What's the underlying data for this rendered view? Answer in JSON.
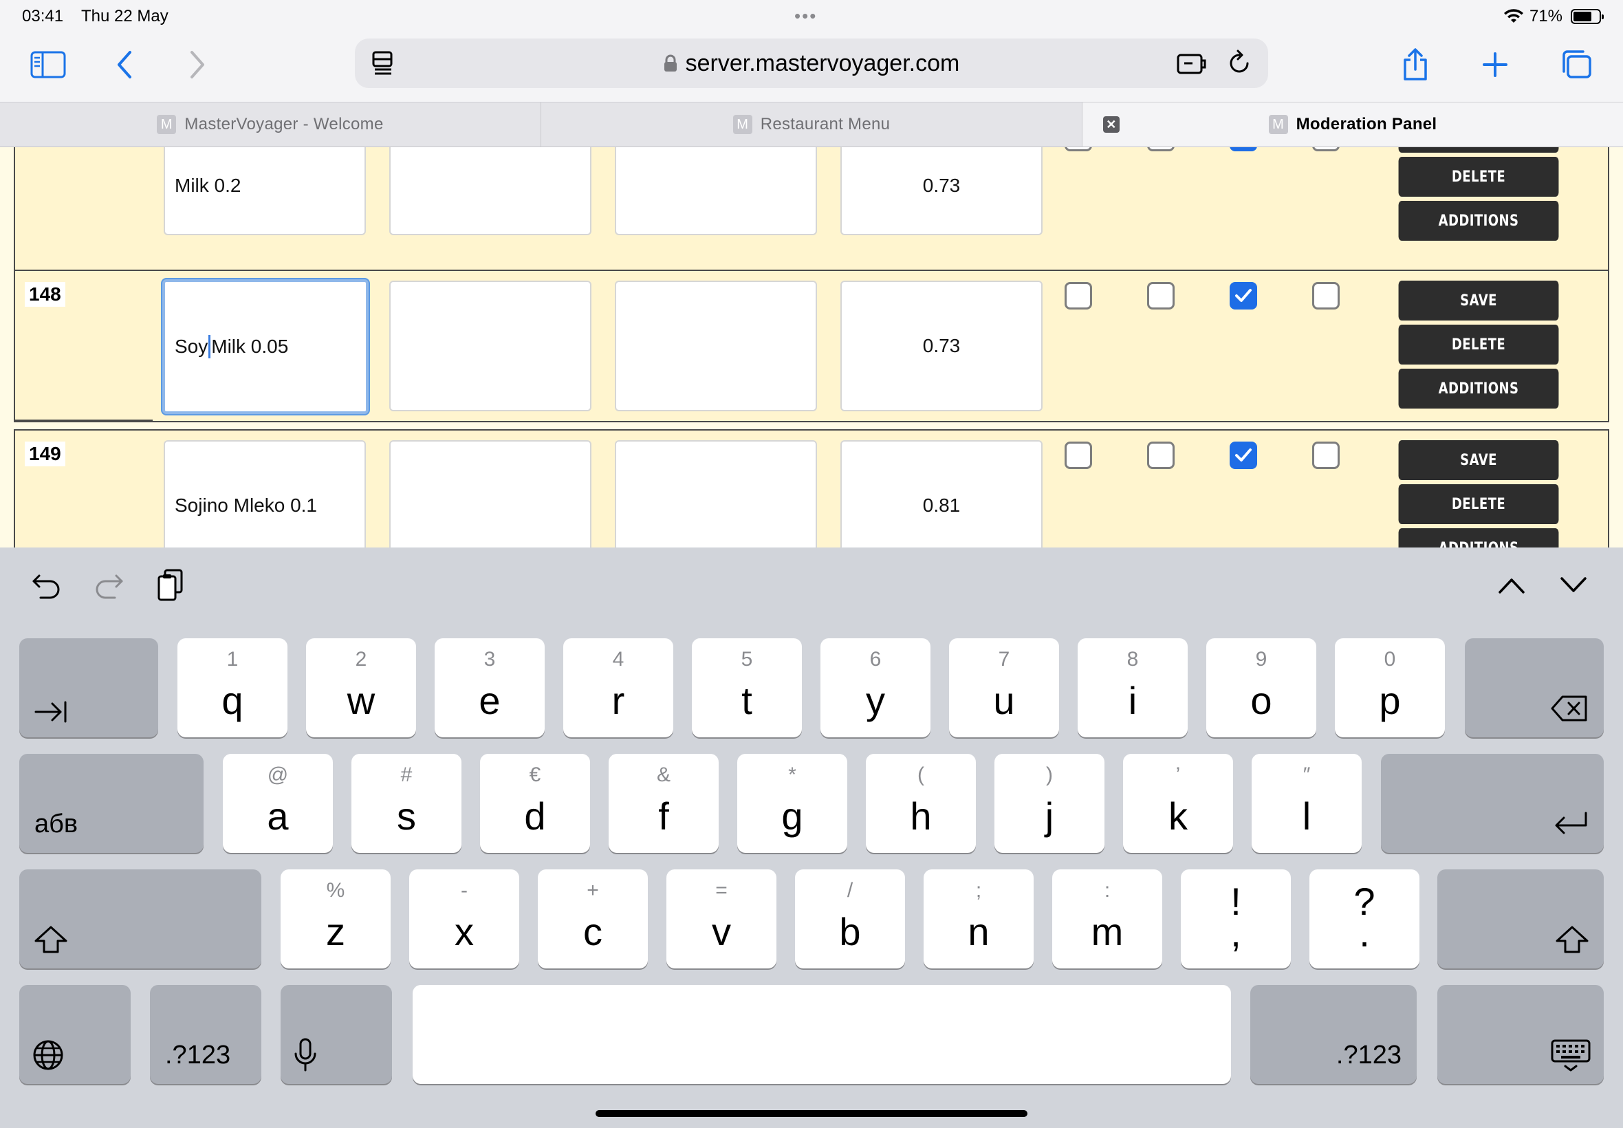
{
  "status": {
    "time": "03:41",
    "date": "Thu 22 May",
    "battery": "71%",
    "battery_level": 0.71
  },
  "toolbar": {
    "url": "server.mastervoyager.com"
  },
  "tabs": [
    {
      "favicon": "M",
      "label": "MasterVoyager - Welcome"
    },
    {
      "favicon": "M",
      "label": "Restaurant Menu"
    },
    {
      "favicon": "M",
      "label": "Moderation Panel",
      "active": true
    }
  ],
  "rows": [
    {
      "id": "",
      "name": "Milk 0.2",
      "price": "0.73",
      "checks": [
        false,
        false,
        true,
        false
      ]
    },
    {
      "id": "148",
      "name_before": "Soy ",
      "name_after": "Milk 0.05",
      "price": "0.73",
      "checks": [
        false,
        false,
        true,
        false
      ]
    },
    {
      "id": "149",
      "name": "Sojino Mleko 0.1",
      "price": "0.81",
      "checks": [
        false,
        false,
        true,
        false
      ]
    }
  ],
  "buttons": {
    "save": "SAVE",
    "delete": "DELETE",
    "additions": "ADDITIONS"
  },
  "keyboard": {
    "row1": [
      {
        "sec": "1",
        "pri": "q"
      },
      {
        "sec": "2",
        "pri": "w"
      },
      {
        "sec": "3",
        "pri": "e"
      },
      {
        "sec": "4",
        "pri": "r"
      },
      {
        "sec": "5",
        "pri": "t"
      },
      {
        "sec": "6",
        "pri": "y"
      },
      {
        "sec": "7",
        "pri": "u"
      },
      {
        "sec": "8",
        "pri": "i"
      },
      {
        "sec": "9",
        "pri": "o"
      },
      {
        "sec": "0",
        "pri": "p"
      }
    ],
    "row2": [
      {
        "sec": "@",
        "pri": "a"
      },
      {
        "sec": "#",
        "pri": "s"
      },
      {
        "sec": "€",
        "pri": "d"
      },
      {
        "sec": "&",
        "pri": "f"
      },
      {
        "sec": "*",
        "pri": "g"
      },
      {
        "sec": "(",
        "pri": "h"
      },
      {
        "sec": ")",
        "pri": "j"
      },
      {
        "sec": "’",
        "pri": "k"
      },
      {
        "sec": "″",
        "pri": "l"
      }
    ],
    "row3": [
      {
        "sec": "%",
        "pri": "z"
      },
      {
        "sec": "-",
        "pri": "x"
      },
      {
        "sec": "+",
        "pri": "c"
      },
      {
        "sec": "=",
        "pri": "v"
      },
      {
        "sec": "/",
        "pri": "b"
      },
      {
        "sec": ";",
        "pri": "n"
      },
      {
        "sec": ":",
        "pri": "m"
      },
      {
        "sec": "!",
        "pri": ","
      },
      {
        "sec": "?",
        "pri": "."
      }
    ],
    "lang_key": "абв",
    "numbers_key": ".?123"
  }
}
